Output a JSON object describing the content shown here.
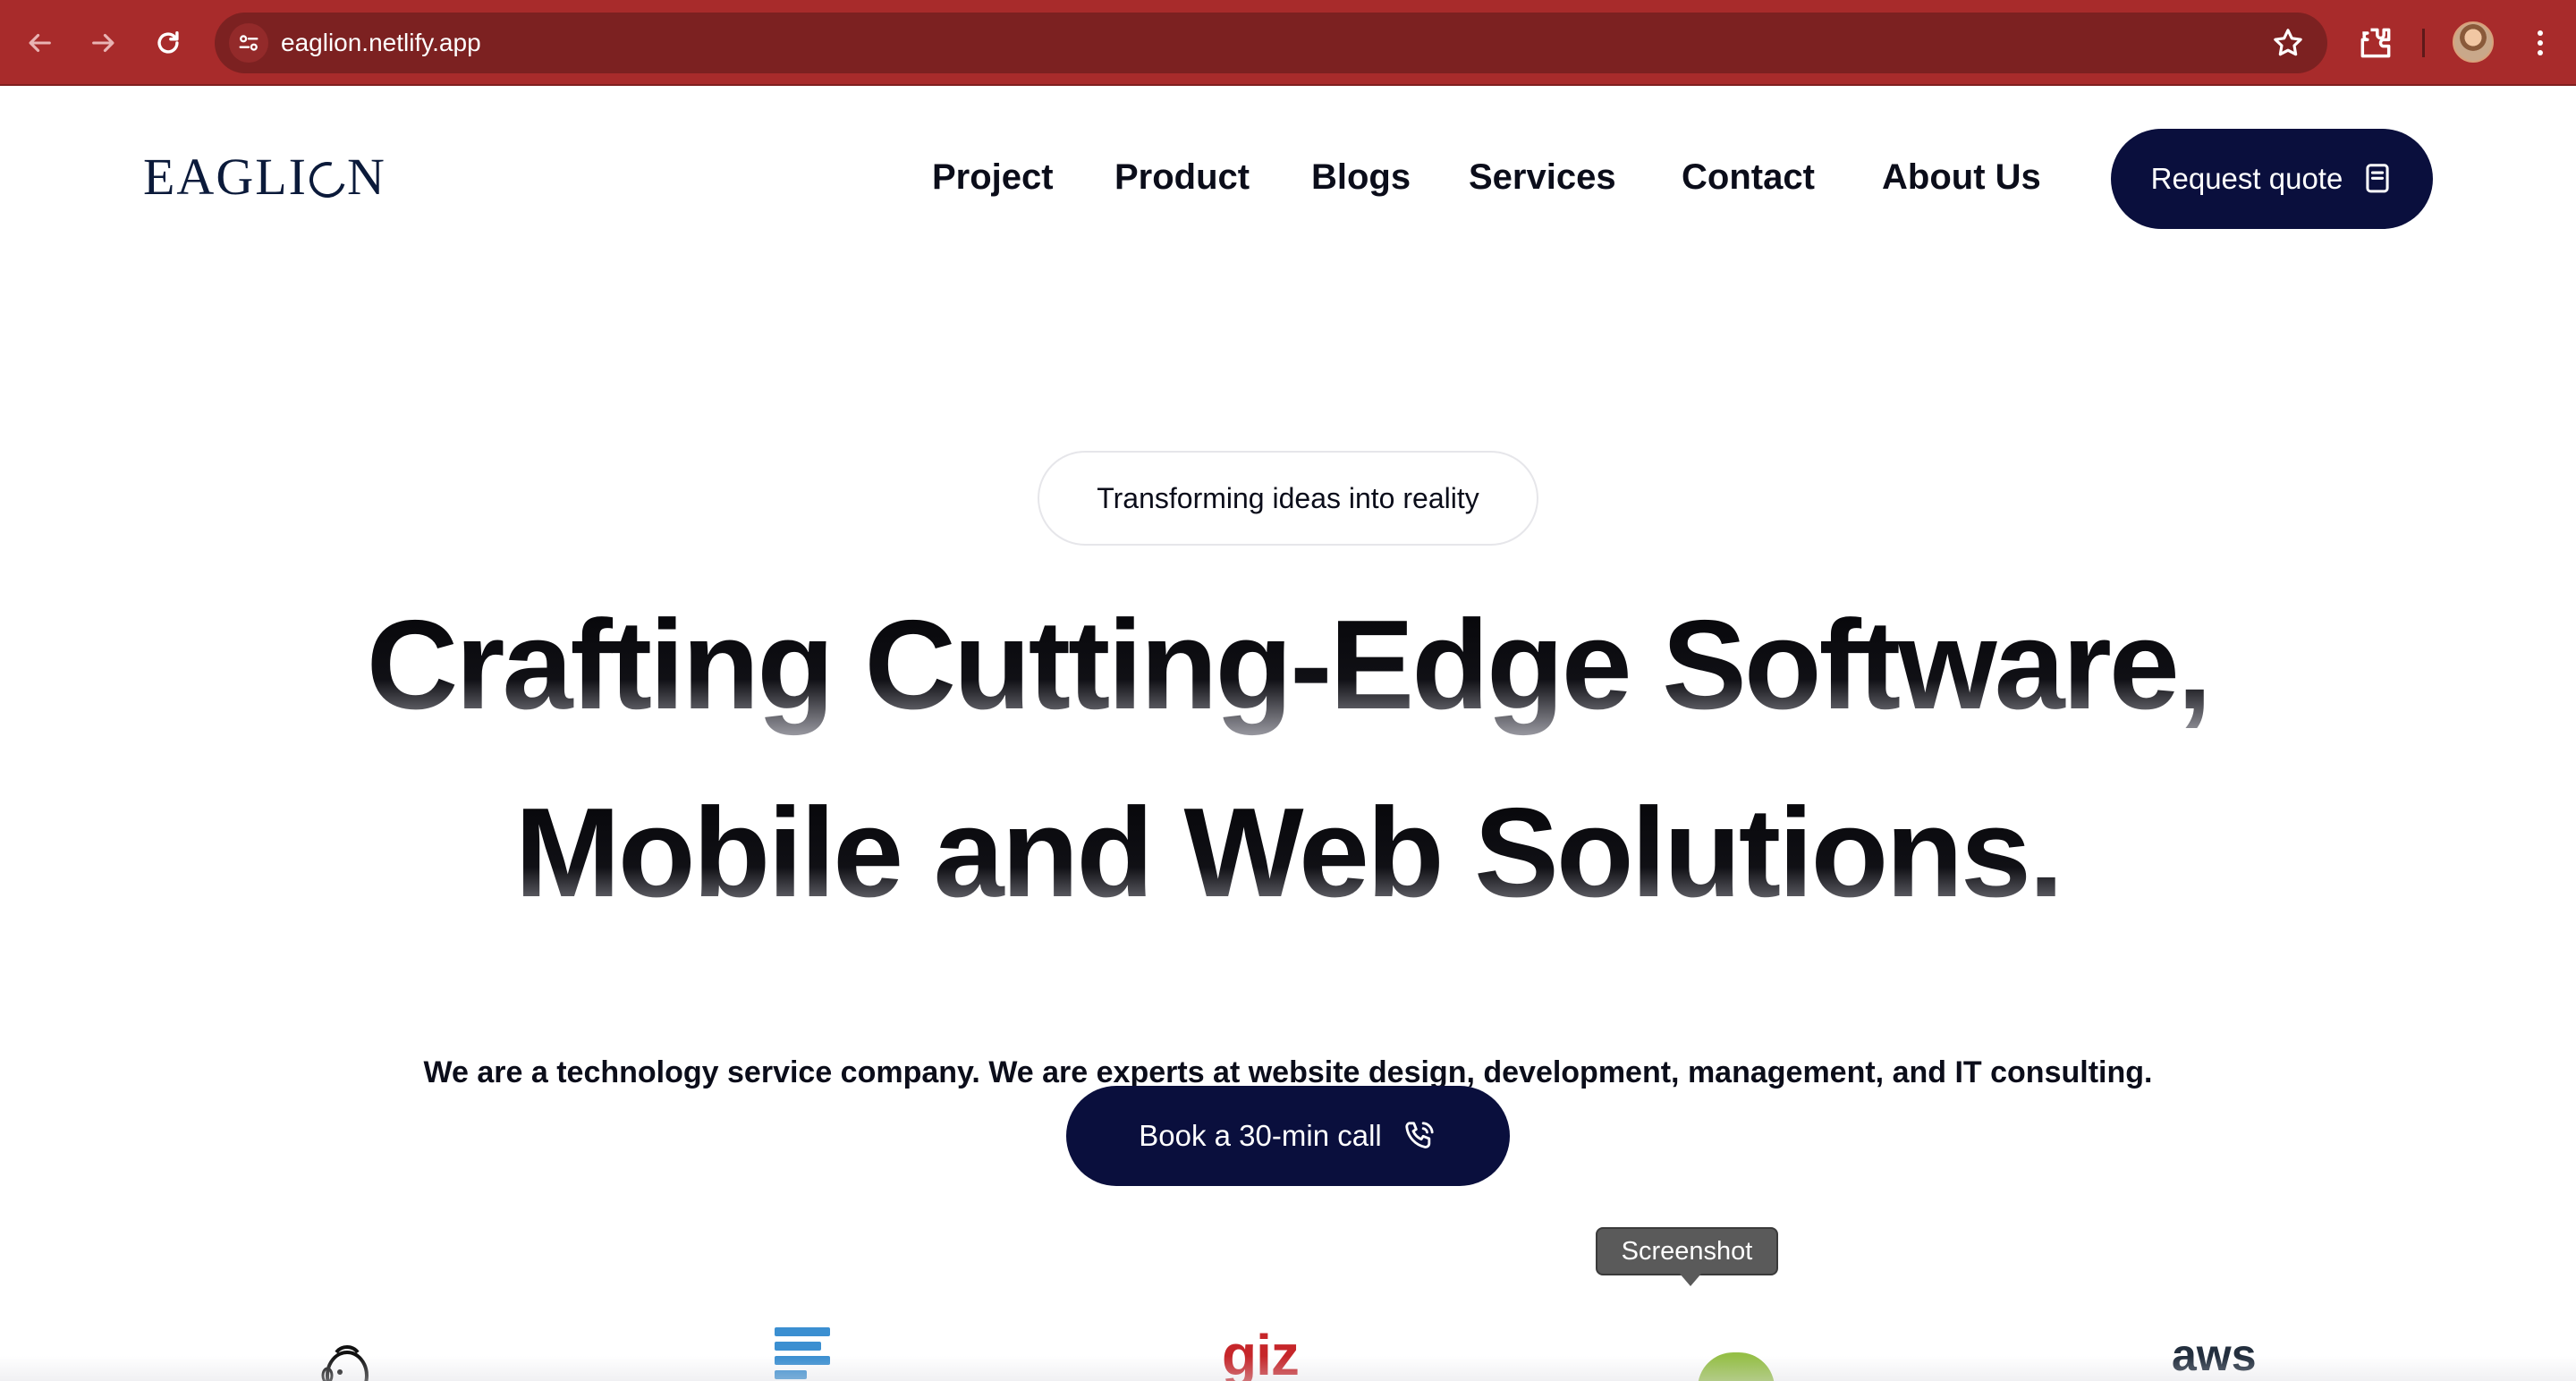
{
  "browser": {
    "url": "eaglion.netlify.app",
    "icons": [
      "back-arrow-icon",
      "forward-arrow-icon",
      "reload-icon",
      "site-info-icon",
      "bookmark-star-icon",
      "extensions-icon",
      "profile-avatar",
      "more-menu-icon"
    ],
    "chrome_color": "#a82b2b"
  },
  "header": {
    "logo_text_1": "EAGLI",
    "logo_text_2": "N",
    "nav": [
      "Project",
      "Product",
      "Blogs",
      "Services",
      "Contact",
      "About Us"
    ],
    "cta_label": "Request quote",
    "cta_icon": "receipt-icon"
  },
  "hero": {
    "tagline": "Transforming ideas into reality",
    "headline_line1": "Crafting Cutting-Edge Software,",
    "headline_line2": "Mobile and Web Solutions.",
    "subheading": "We are a technology service company. We are experts at website design, development, management, and IT consulting.",
    "cta_label": "Book a 30-min call",
    "cta_icon": "phone-call-icon",
    "accent_color": "#0a0f3d"
  },
  "partners": {
    "logos": [
      "mailchimp-logo",
      "stack-logo",
      "giz",
      "shopify-logo",
      "aws"
    ],
    "giz_text": "giz",
    "aws_text": "aws"
  },
  "tooltip": {
    "text": "Screenshot"
  }
}
